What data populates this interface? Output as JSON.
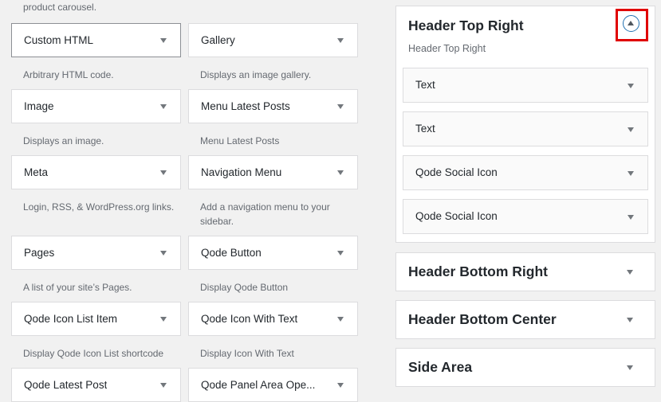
{
  "available": {
    "carousel_desc": "product carousel.",
    "rows": [
      {
        "left": {
          "title": "Custom HTML",
          "desc": "Arbitrary HTML code."
        },
        "right": {
          "title": "Gallery",
          "desc": "Displays an image gallery."
        }
      },
      {
        "left": {
          "title": "Image",
          "desc": "Displays an image."
        },
        "right": {
          "title": "Menu Latest Posts",
          "desc": "Menu Latest Posts"
        }
      },
      {
        "left": {
          "title": "Meta",
          "desc": "Login, RSS, & WordPress.org links."
        },
        "right": {
          "title": "Navigation Menu",
          "desc": "Add a navigation menu to your sidebar."
        }
      },
      {
        "left": {
          "title": "Pages",
          "desc": "A list of your site’s Pages."
        },
        "right": {
          "title": "Qode Button",
          "desc": "Display Qode Button"
        }
      },
      {
        "left": {
          "title": "Qode Icon List Item",
          "desc": "Display Qode Icon List shortcode"
        },
        "right": {
          "title": "Qode Icon With Text",
          "desc": "Display Icon With Text"
        }
      },
      {
        "left": {
          "title": "Qode Latest Post"
        },
        "right": {
          "title": "Qode Panel Area Ope..."
        }
      }
    ]
  },
  "sidebars": {
    "open": {
      "title": "Header Top Right",
      "description": "Header Top Right",
      "toggle_icon": "chevron-up-icon",
      "highlight_color": "#e00000",
      "widgets": [
        "Text",
        "Text",
        "Qode Social Icon",
        "Qode Social Icon"
      ]
    },
    "closed": [
      "Header Bottom Right",
      "Header Bottom Center",
      "Side Area"
    ]
  }
}
